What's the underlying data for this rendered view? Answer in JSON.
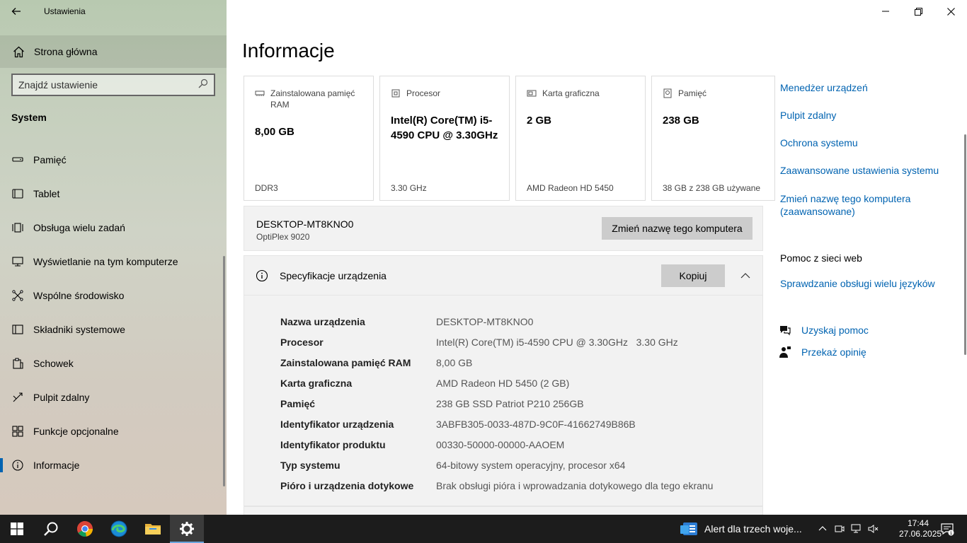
{
  "window": {
    "title": "Ustawienia"
  },
  "sidebar": {
    "home_label": "Strona główna",
    "search_placeholder": "Znajdź ustawienie",
    "section": "System",
    "items": [
      {
        "label": "Pamięć",
        "icon": "storage-icon"
      },
      {
        "label": "Tablet",
        "icon": "tablet-icon"
      },
      {
        "label": "Obsługa wielu zadań",
        "icon": "multitasking-icon"
      },
      {
        "label": "Wyświetlanie na tym komputerze",
        "icon": "projecting-icon"
      },
      {
        "label": "Wspólne środowisko",
        "icon": "shared-experiences-icon"
      },
      {
        "label": "Składniki systemowe",
        "icon": "system-components-icon"
      },
      {
        "label": "Schowek",
        "icon": "clipboard-icon"
      },
      {
        "label": "Pulpit zdalny",
        "icon": "remote-desktop-icon"
      },
      {
        "label": "Funkcje opcjonalne",
        "icon": "optional-features-icon"
      },
      {
        "label": "Informacje",
        "icon": "info-icon",
        "active": true
      }
    ]
  },
  "main": {
    "title": "Informacje",
    "cards": [
      {
        "label": "Zainstalowana pamięć RAM",
        "value": "8,00 GB",
        "footer": "DDR3",
        "icon": "ram-icon"
      },
      {
        "label": "Procesor",
        "value": "Intel(R) Core(TM) i5-4590 CPU @ 3.30GHz",
        "footer": "3.30 GHz",
        "icon": "cpu-icon"
      },
      {
        "label": "Karta graficzna",
        "value": "2 GB",
        "footer": "AMD Radeon HD 5450",
        "icon": "gpu-icon"
      },
      {
        "label": "Pamięć",
        "value": "238 GB",
        "footer": "38 GB z 238 GB używane",
        "icon": "disk-icon"
      }
    ],
    "device": {
      "name": "DESKTOP-MT8KNO0",
      "model": "OptiPlex 9020",
      "rename_button": "Zmień nazwę tego komputera"
    },
    "spec": {
      "title": "Specyfikacje urządzenia",
      "copy_button": "Kopiuj",
      "rows": [
        {
          "k": "Nazwa urządzenia",
          "v": "DESKTOP-MT8KNO0"
        },
        {
          "k": "Procesor",
          "v": "Intel(R) Core(TM) i5-4590 CPU @ 3.30GHz   3.30 GHz"
        },
        {
          "k": "Zainstalowana pamięć RAM",
          "v": "8,00 GB"
        },
        {
          "k": "Karta graficzna",
          "v": "AMD Radeon HD 5450 (2 GB)"
        },
        {
          "k": "Pamięć",
          "v": "238 GB SSD Patriot P210 256GB"
        },
        {
          "k": "Identyfikator urządzenia",
          "v": "3ABFB305-0033-487D-9C0F-41662749B86B"
        },
        {
          "k": "Identyfikator produktu",
          "v": "00330-50000-00000-AAOEM"
        },
        {
          "k": "Typ systemu",
          "v": "64-bitowy system operacyjny, procesor x64"
        },
        {
          "k": "Pióro i urządzenia dotykowe",
          "v": "Brak obsługi pióra i wprowadzania dotykowego dla tego ekranu"
        }
      ]
    }
  },
  "related": {
    "links": [
      "Menedżer urządzeń",
      "Pulpit zdalny",
      "Ochrona systemu",
      "Zaawansowane ustawienia systemu",
      "Zmień nazwę tego komputera (zaawansowane)"
    ],
    "web_help_heading": "Pomoc z sieci web",
    "web_help_link": "Sprawdzanie obsługi wielu języków",
    "get_help": "Uzyskaj pomoc",
    "feedback": "Przekaż opinię"
  },
  "taskbar": {
    "news": "Alert dla trzech woje...",
    "time": "17:44",
    "date": "27.06.2025",
    "notification_count": "1"
  },
  "colors": {
    "accent": "#0063b1",
    "taskbar": "#1c1c1c"
  }
}
